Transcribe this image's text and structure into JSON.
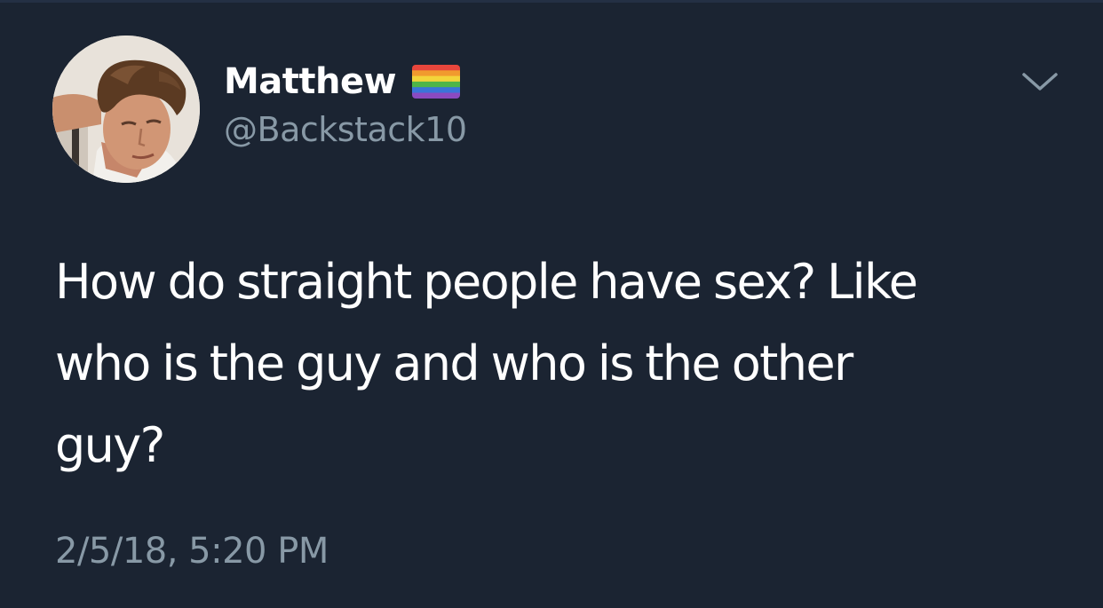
{
  "tweet": {
    "author": {
      "display_name": "Matthew",
      "handle": "@Backstack10",
      "avatar_icon": "profile-photo",
      "name_badge_icon": "rainbow-flag-icon"
    },
    "menu_icon": "chevron-down-icon",
    "text": "How do straight people have sex? Like\nwho is the guy and who is the other\nguy?",
    "timestamp": "2/5/18, 5:20 PM"
  },
  "colors": {
    "background": "#1b2432",
    "primary_text": "#ffffff",
    "secondary_text": "#8899a6"
  }
}
